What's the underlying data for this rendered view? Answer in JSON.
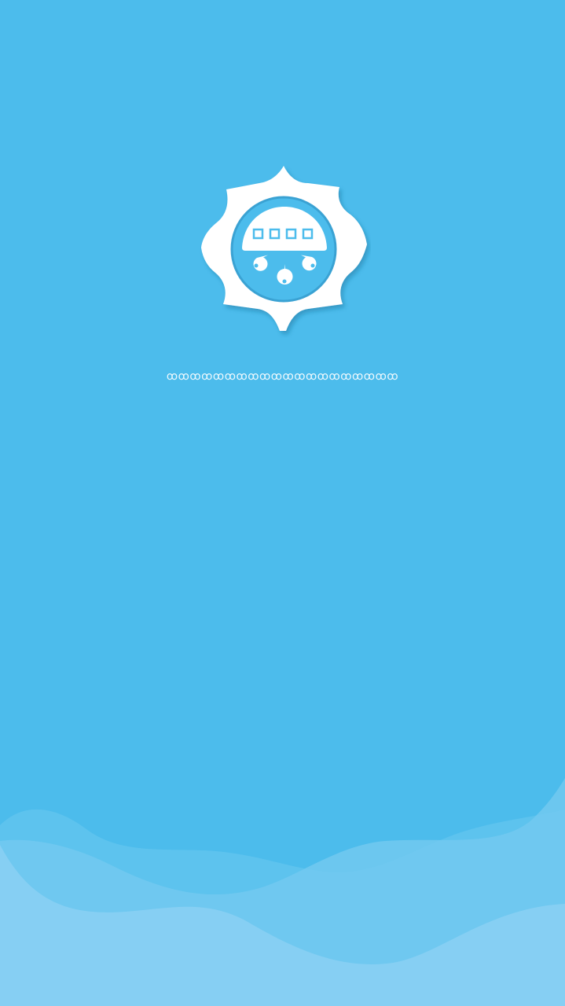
{
  "splash": {
    "background_color": "#4CBCEC",
    "logo_icon": "water-meter-gear-icon",
    "logo_color": "#FFFFFF",
    "loading_text": "ꝏꝏꝏꝏꝏꝏꝏꝏꝏꝏꝏꝏꝏꝏꝏꝏꝏꝏꝏꝏ",
    "wave_icon": "wave-decoration-icon"
  }
}
